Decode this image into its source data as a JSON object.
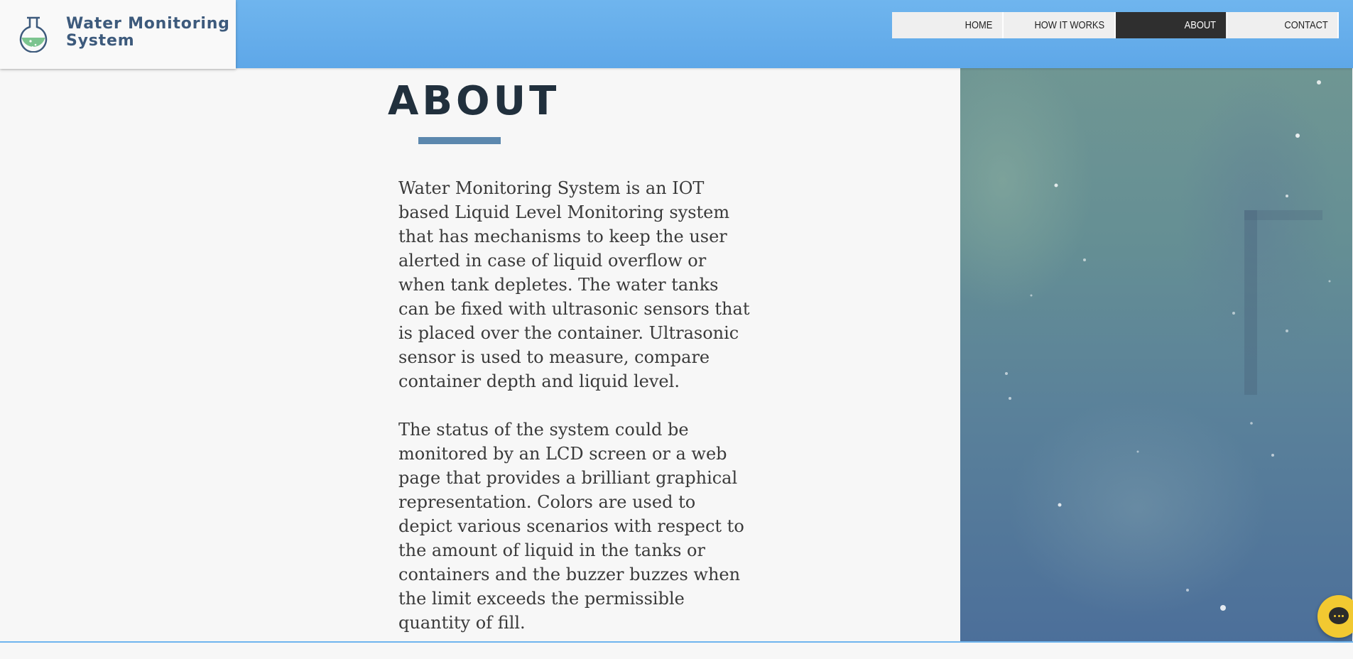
{
  "site": {
    "logo_line1": "Water Monitoring",
    "logo_line2": "System",
    "logo_icon": "flask-icon"
  },
  "nav": {
    "items": [
      {
        "label": "HOME",
        "active": false
      },
      {
        "label": "HOW IT WORKS",
        "active": false
      },
      {
        "label": "ABOUT",
        "active": true
      },
      {
        "label": "CONTACT",
        "active": false
      }
    ]
  },
  "about": {
    "title": "ABOUT",
    "paragraph1": "Water Monitoring System is an IOT based Liquid Level Monitoring system that has mechanisms to keep the user alerted in case of liquid overflow or when tank depletes. The water tanks can be fixed with ultrasonic sensors that is placed over the container. Ultrasonic sensor is used to measure, compare container depth and liquid level.",
    "paragraph2": "The status of the system could be monitored by an LCD screen or a web page that provides a brilliant graphical representation. Colors are used to depict various scenarios with respect to the amount of liquid in the tanks or containers and the buzzer buzzes when the limit exceeds the permissible quantity of fill."
  },
  "chat": {
    "icon": "chat-bubble-icon"
  },
  "colors": {
    "header_blue": "#5ea7e8",
    "title_dark": "#21303d",
    "accent_rule": "#5c88ae",
    "nav_active_bg": "#2f2f2f",
    "chat_yellow": "#f2c931"
  }
}
